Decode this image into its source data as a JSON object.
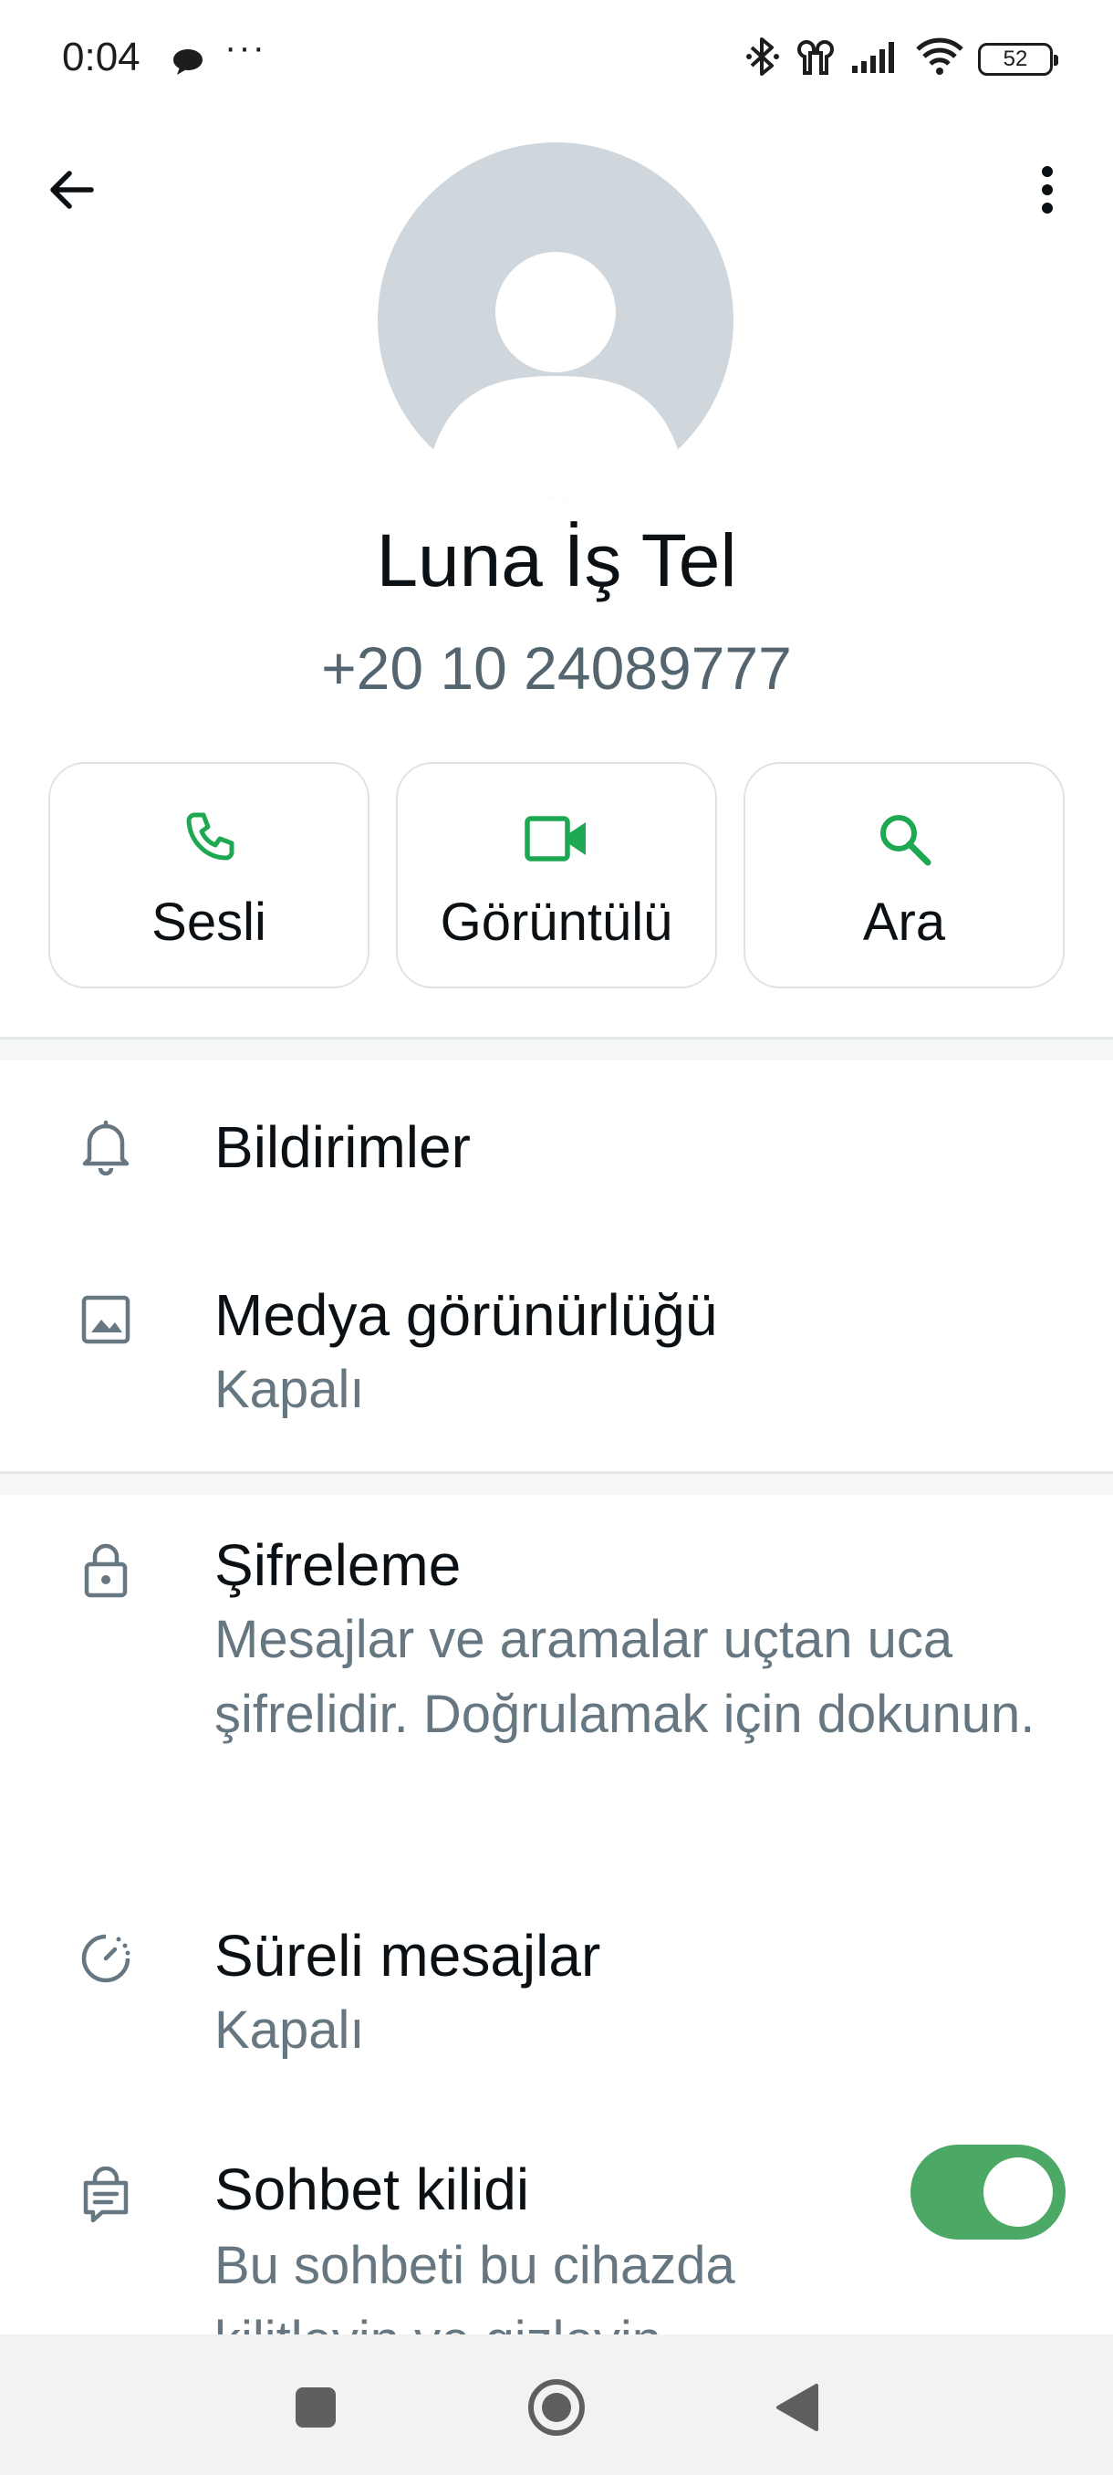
{
  "status_bar": {
    "time": "0:04",
    "more": "···",
    "battery": "52"
  },
  "contact": {
    "name": "Luna İş Tel",
    "phone": "+20 10 24089777"
  },
  "actions": [
    {
      "label": "Sesli",
      "icon": "phone-icon"
    },
    {
      "label": "Görüntülü",
      "icon": "video-icon"
    },
    {
      "label": "Ara",
      "icon": "search-icon"
    }
  ],
  "settings": {
    "notifications": {
      "title": "Bildirimler",
      "icon": "bell-icon"
    },
    "media_visibility": {
      "title": "Medya görünürlüğü",
      "value": "Kapalı",
      "icon": "image-icon"
    },
    "encryption": {
      "title": "Şifreleme",
      "description": "Mesajlar ve aramalar uçtan uca şifrelidir. Doğrulamak için dokunun.",
      "icon": "lock-icon"
    },
    "disappearing": {
      "title": "Süreli mesajlar",
      "value": "Kapalı",
      "icon": "timer-icon"
    },
    "chat_lock": {
      "title": "Sohbet kilidi",
      "description": "Bu sohbeti bu cihazda kilitleyin ve gizleyin.",
      "enabled": true,
      "icon": "chat-lock-icon"
    }
  },
  "colors": {
    "accent": "#1da851",
    "toggle_on": "#4ba965",
    "text_primary": "#0b1014",
    "text_secondary": "#667781"
  }
}
